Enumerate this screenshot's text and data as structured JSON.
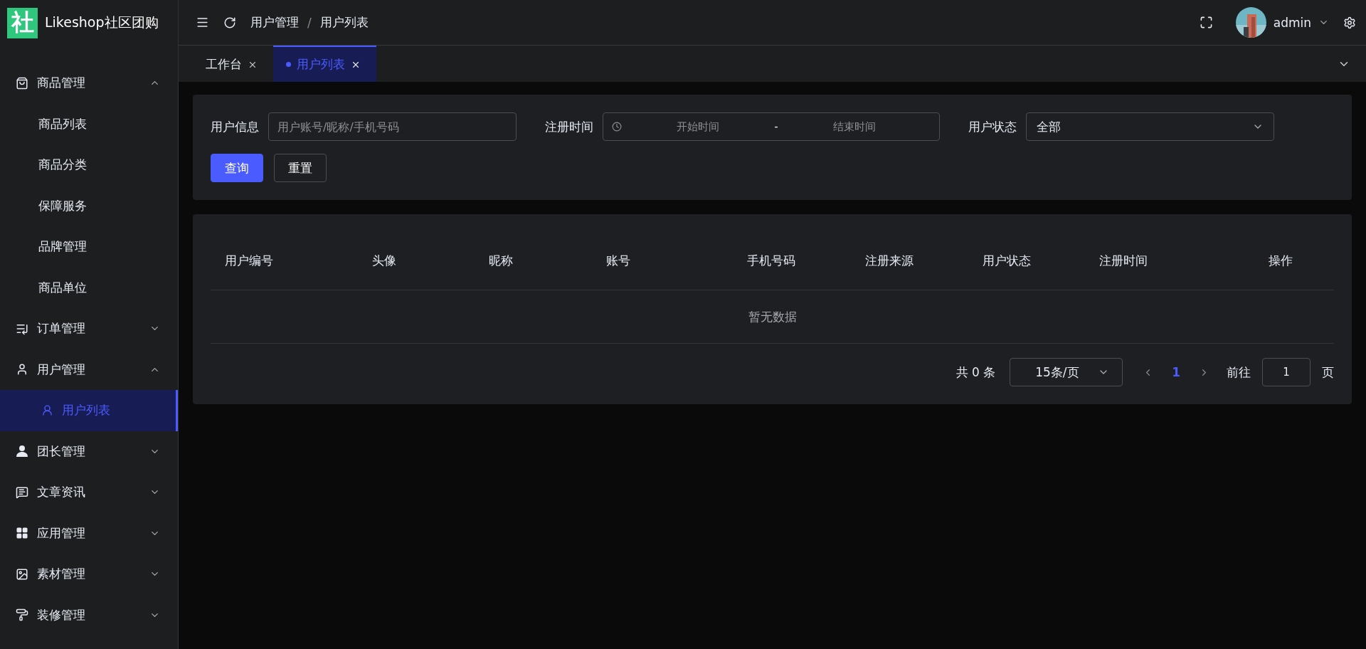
{
  "logo": {
    "mark": "社",
    "name": "Likeshop社区团购"
  },
  "menu": [
    {
      "label": "商品管理",
      "expanded": true,
      "children": [
        {
          "label": "商品列表",
          "kind": "text-item",
          "selected": false
        },
        {
          "label": "商品分类",
          "kind": "text-item",
          "selected": false
        },
        {
          "label": "保障服务",
          "kind": "text-item",
          "selected": false
        },
        {
          "label": "品牌管理",
          "kind": "text-item",
          "selected": false
        },
        {
          "label": "商品单位",
          "kind": "text-item",
          "selected": false
        }
      ]
    },
    {
      "label": "订单管理",
      "expanded": false
    },
    {
      "label": "用户管理",
      "expanded": true,
      "children": [
        {
          "label": "用户列表",
          "kind": "icon-item",
          "selected": true
        }
      ]
    },
    {
      "label": "团长管理",
      "expanded": false
    },
    {
      "label": "文章资讯",
      "expanded": false
    },
    {
      "label": "应用管理",
      "expanded": false
    },
    {
      "label": "素材管理",
      "expanded": false
    },
    {
      "label": "装修管理",
      "expanded": false
    }
  ],
  "header": {
    "breadcrumb": [
      "用户管理",
      "用户列表"
    ],
    "separator": "/",
    "user": "admin"
  },
  "tabs": [
    {
      "label": "工作台",
      "selected": false
    },
    {
      "label": "用户列表",
      "selected": true
    }
  ],
  "filters": [
    {
      "kind": "text",
      "label": "用户信息",
      "placeholder": "用户账号/昵称/手机号码"
    },
    {
      "kind": "daterange",
      "label": "注册时间",
      "start_placeholder": "开始时间",
      "separator": "-",
      "end_placeholder": "结束时间"
    },
    {
      "kind": "select",
      "label": "用户状态",
      "value": "全部"
    }
  ],
  "buttons": [
    {
      "label": "查询",
      "kind": "primary"
    },
    {
      "label": "重置",
      "kind": "default"
    }
  ],
  "table": {
    "columns": [
      "用户编号",
      "头像",
      "昵称",
      "账号",
      "手机号码",
      "注册来源",
      "用户状态",
      "注册时间",
      "操作"
    ],
    "empty_text": "暂无数据"
  },
  "pagination": {
    "total": "共 0 条",
    "page_size": "15条/页",
    "pages": [
      {
        "label": "1",
        "selected": true
      }
    ],
    "goto_label": "前往",
    "goto_value": "1",
    "page_unit": "页"
  }
}
